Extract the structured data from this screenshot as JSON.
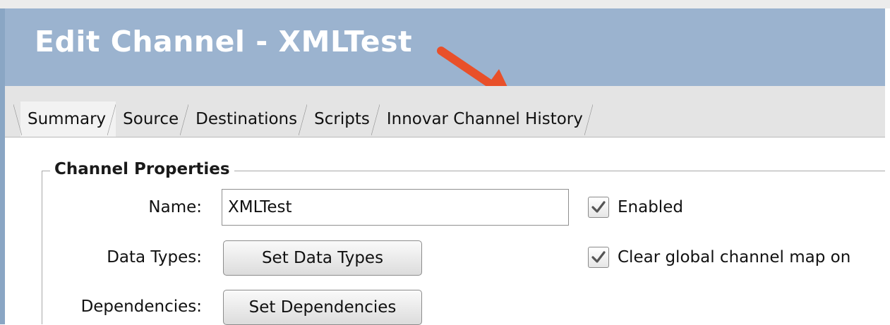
{
  "window": {
    "title": "Edit Channel - XMLTest"
  },
  "tabs": [
    {
      "label": "Summary",
      "active": true
    },
    {
      "label": "Source",
      "active": false
    },
    {
      "label": "Destinations",
      "active": false
    },
    {
      "label": "Scripts",
      "active": false
    },
    {
      "label": "Innovar Channel History",
      "active": false
    }
  ],
  "channel_properties": {
    "group_title": "Channel Properties",
    "name_label": "Name:",
    "name_value": "XMLTest",
    "data_types_label": "Data Types:",
    "data_types_button": "Set Data Types",
    "dependencies_label": "Dependencies:",
    "dependencies_button": "Set Dependencies",
    "enabled_label": "Enabled",
    "enabled_checked": true,
    "clear_map_label": "Clear global channel map on",
    "clear_map_checked": true
  },
  "colors": {
    "title_bar": "#9bb3cf",
    "annotation_arrow": "#e8502a"
  },
  "icons": {
    "annotation": "red-arrow-icon",
    "checkbox": "checkmark-icon"
  }
}
